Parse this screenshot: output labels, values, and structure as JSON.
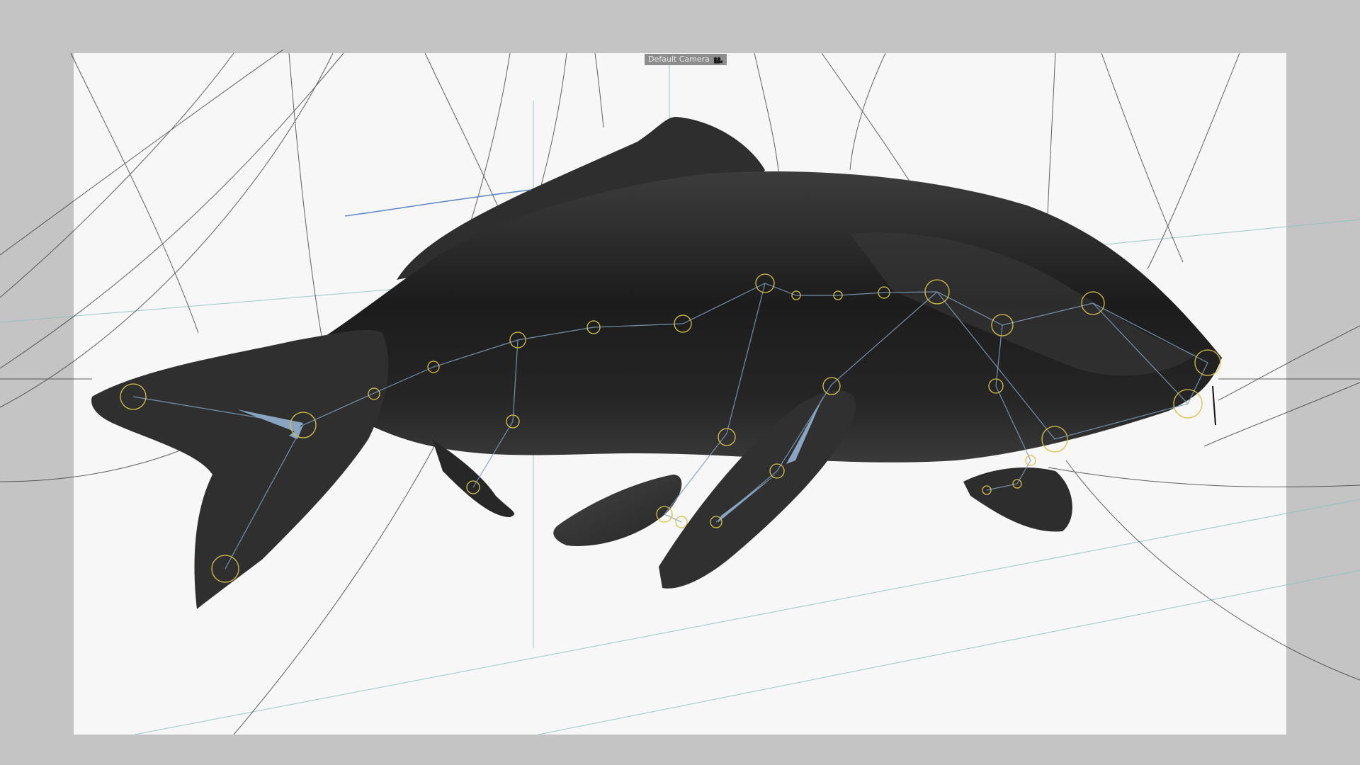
{
  "viewport": {
    "camera_label": "Default Camera",
    "camera_icon": "camera-icon"
  },
  "scene": {
    "object": "fish-mesh",
    "rig": "fish-skeleton-rig",
    "colors": {
      "outside_safe_frame": "#c4c4c4",
      "render_region": "#f7f7f7",
      "mesh": "#2b2b2b",
      "bone_fill": "#7f9bb8",
      "joint_ring": "#d6c24a",
      "grid_line": "#8fc3bd",
      "wire_line": "#3a3a3a"
    }
  }
}
